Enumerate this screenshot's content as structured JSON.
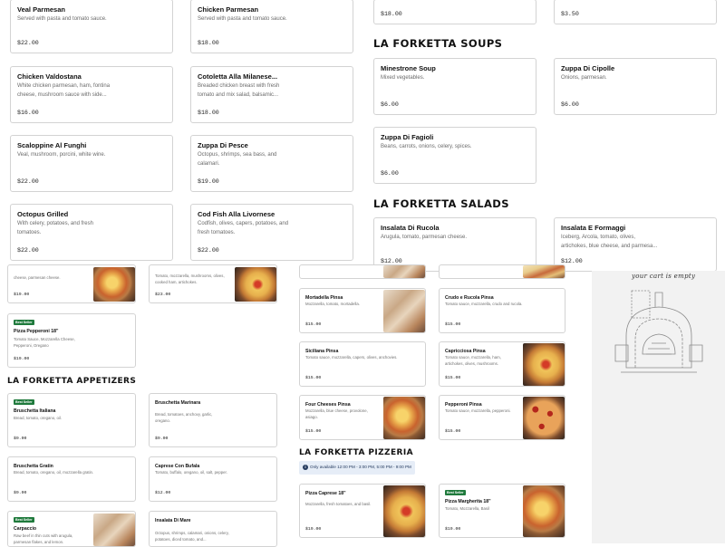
{
  "top": {
    "left_cards": [
      {
        "name": "Veal Parmesan",
        "desc": "Served with pasta and tomato sauce.",
        "price": "$22.00"
      },
      {
        "name": "Chicken Parmesan",
        "desc": "Served with pasta and tomato sauce.",
        "price": "$18.00"
      },
      {
        "name": "Chicken Valdostana",
        "desc": "White chicken parmesan, ham, fontina cheese, mushroom sauce with side...",
        "price": "$16.00"
      },
      {
        "name": "Cotoletta Alla Milanese...",
        "desc": "Breaded chicken breast with fresh tomato and mix salad, balsamic...",
        "price": "$18.00"
      },
      {
        "name": "Scaloppine Al Funghi",
        "desc": "Veal, mushroom, porcini, white wine.",
        "price": "$22.00"
      },
      {
        "name": "Zuppa Di Pesce",
        "desc": "Octopus, shrimps, sea bass, and calamari.",
        "price": "$19.00"
      },
      {
        "name": "Octopus Grilled",
        "desc": "With celery, potatoes, and fresh tomatoes.",
        "price": "$22.00"
      },
      {
        "name": "Cod Fish Alla Livornese",
        "desc": "Codfish, olives, capers, potatoes, and fresh tomatoes.",
        "price": "$22.00"
      }
    ],
    "partial_prices": [
      "$18.00",
      "$3.50"
    ],
    "soups_title": "LA FORKETTA SOUPS",
    "soups": [
      {
        "name": "Minestrone Soup",
        "desc": "Mixed vegetables.",
        "price": "$6.00"
      },
      {
        "name": "Zuppa Di Cipolle",
        "desc": "Onions, parmesan.",
        "price": "$6.00"
      },
      {
        "name": "Zuppa Di Fagioli",
        "desc": "Beans, carrots, onions, celery, spices.",
        "price": "$6.00"
      }
    ],
    "salads_title": "LA FORKETTA SALADS",
    "salads": [
      {
        "name": "Insalata Di Rucola",
        "desc": "Arugula, tomato, parmesan cheese.",
        "price": "$12.00"
      },
      {
        "name": "Insalata E Formaggi",
        "desc": "Iceberg, Arcola, tomato, olives, artichokes, blue cheese, and parmesa...",
        "price": "$12.00"
      }
    ]
  },
  "bottom": {
    "pizzas_top": [
      {
        "desc": "cheese, parmesan cheese.",
        "price": "$19.00"
      },
      {
        "desc": "Tomato, mozzarella, mushrooms, olives, cooked ham, artichokes.",
        "price": "$23.00"
      }
    ],
    "pepperoni": {
      "badge": "Best Seller",
      "name": "Pizza Pepperoni 18\"",
      "desc": "Tomato Sauce, Mozzarella Cheese, Pepperoni, Oregano",
      "price": "$19.00"
    },
    "appetizers_title": "LA FORKETTA APPETIZERS",
    "appetizers": [
      {
        "badge": "Best Seller",
        "name": "Bruschetta Italiana",
        "desc": "Bread, tomato, oregano, oil.",
        "price": "$9.00"
      },
      {
        "badge": "",
        "name": "Bruschetta Marinara",
        "desc": "Bread, tomatoes, anchovy, garlic, oregano.",
        "price": "$9.00"
      },
      {
        "badge": "",
        "name": "Bruschetta Gratin",
        "desc": "Bread, tomato, oregano, oil, mozzarella gratin.",
        "price": "$9.00"
      },
      {
        "badge": "",
        "name": "Caprese Con Bufala",
        "desc": "Tomato, buffalo, oregano, oil, salt, pepper.",
        "price": "$12.00"
      },
      {
        "badge": "Best Seller",
        "name": "Carpaccio",
        "desc": "Raw beef in thin cuts with arugula, parmesan flakes, and lemon.",
        "price": ""
      },
      {
        "badge": "",
        "name": "Insalata Di Mare",
        "desc": "Octopus, shrimps, calamari, onions, celery, potatoes, diced tomato, and...",
        "price": ""
      }
    ],
    "pinsas": [
      {
        "name": "Mortadella Pinsa",
        "desc": "Mozzarella, tomato, mortadella.",
        "price": "$15.00"
      },
      {
        "name": "Crudo e Rucola Pinsa",
        "desc": "Tomato sauce, mozzarella, crudo and rucola.",
        "price": "$15.00"
      },
      {
        "name": "Siciliana Pinsa",
        "desc": "Tomato sauce, mozzarella, capers, olives, anchovies.",
        "price": "$15.00"
      },
      {
        "name": "Capricciosa Pinsa",
        "desc": "Tomato sauce, mozzarella, ham, artichokes, olives, mushrooms.",
        "price": "$15.00"
      },
      {
        "name": "Four Cheeses Pinsa",
        "desc": "Mozzarella, blue cheese, provolone, asiago.",
        "price": "$15.00"
      },
      {
        "name": "Pepperoni Pinsa",
        "desc": "Tomato sauce, mozzarella, pepperoni.",
        "price": "$15.00"
      }
    ],
    "pizzeria_title": "LA FORKETTA PIZZERIA",
    "availability": "Only available 12:00 PM - 3:00 PM, 5:00 PM - 9:00 PM",
    "pizzeria": [
      {
        "badge": "",
        "name": "Pizza Caprese 18\"",
        "desc": "Mozzarella, fresh tomatoes, and basil.",
        "price": "$19.00"
      },
      {
        "badge": "Best Seller",
        "name": "Pizza Margherita 18\"",
        "desc": "Tomato, Mozzarella, Basil",
        "price": "$19.00"
      }
    ],
    "cart_text": "your cart is empty"
  }
}
